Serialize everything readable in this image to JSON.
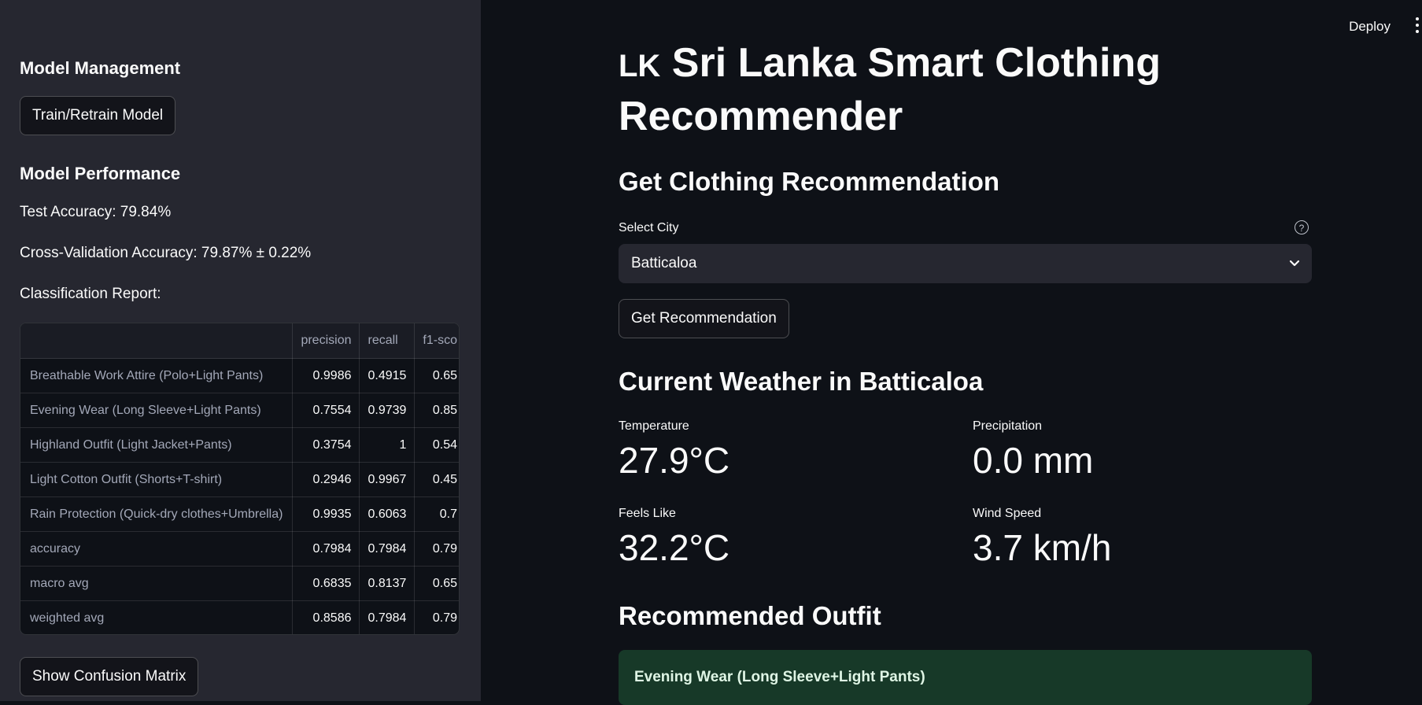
{
  "sidebar": {
    "model_management_heading": "Model Management",
    "train_button": "Train/Retrain Model",
    "model_performance_heading": "Model Performance",
    "test_accuracy": "Test Accuracy: 79.84%",
    "cv_accuracy": "Cross-Validation Accuracy: 79.87% ± 0.22%",
    "classification_report_label": "Classification Report:",
    "report": {
      "columns": [
        "",
        "precision",
        "recall",
        "f1-sco"
      ],
      "rows": [
        {
          "label": "Breathable Work Attire (Polo+Light Pants)",
          "precision": "0.9986",
          "recall": "0.4915",
          "f1": "0.65"
        },
        {
          "label": "Evening Wear (Long Sleeve+Light Pants)",
          "precision": "0.7554",
          "recall": "0.9739",
          "f1": "0.85"
        },
        {
          "label": "Highland Outfit (Light Jacket+Pants)",
          "precision": "0.3754",
          "recall": "1",
          "f1": "0.54"
        },
        {
          "label": "Light Cotton Outfit (Shorts+T-shirt)",
          "precision": "0.2946",
          "recall": "0.9967",
          "f1": "0.45"
        },
        {
          "label": "Rain Protection (Quick-dry clothes+Umbrella)",
          "precision": "0.9935",
          "recall": "0.6063",
          "f1": "0.7"
        },
        {
          "label": "accuracy",
          "precision": "0.7984",
          "recall": "0.7984",
          "f1": "0.79"
        },
        {
          "label": "macro avg",
          "precision": "0.6835",
          "recall": "0.8137",
          "f1": "0.65"
        },
        {
          "label": "weighted avg",
          "precision": "0.8586",
          "recall": "0.7984",
          "f1": "0.79"
        }
      ]
    },
    "confusion_button": "Show Confusion Matrix"
  },
  "header": {
    "deploy_label": "Deploy"
  },
  "main": {
    "title_flag": "LK",
    "title": "Sri Lanka Smart Clothing Recommender",
    "get_rec_heading": "Get Clothing Recommendation",
    "select_city_label": "Select City",
    "selected_city": "Batticaloa",
    "get_rec_button": "Get Recommendation",
    "weather_heading": "Current Weather in Batticaloa",
    "metrics": {
      "temperature_label": "Temperature",
      "temperature_value": "27.9°C",
      "precipitation_label": "Precipitation",
      "precipitation_value": "0.0 mm",
      "feels_like_label": "Feels Like",
      "feels_like_value": "32.2°C",
      "wind_speed_label": "Wind Speed",
      "wind_speed_value": "3.7 km/h"
    },
    "outfit_heading": "Recommended Outfit",
    "outfit_value": "Evening Wear (Long Sleeve+Light Pants)"
  },
  "colors": {
    "app_bg": "#0e1117",
    "sidebar_bg": "#262730",
    "success_bg": "#173928"
  },
  "icons": [
    "help-icon",
    "chevron-down-icon",
    "menu-dots-icon"
  ]
}
